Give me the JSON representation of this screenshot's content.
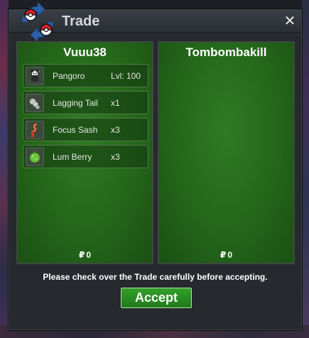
{
  "window": {
    "title": "Trade",
    "close_symbol": "✕"
  },
  "left_trader": {
    "name": "Vuuu38",
    "items": [
      {
        "name": "Pangoro",
        "qty": "Lvl: 100",
        "icon": "pangoro-icon"
      },
      {
        "name": "Lagging Tail",
        "qty": "x1",
        "icon": "lagging-tail-icon"
      },
      {
        "name": "Focus Sash",
        "qty": "x3",
        "icon": "focus-sash-icon"
      },
      {
        "name": "Lum Berry",
        "qty": "x3",
        "icon": "lum-berry-icon"
      }
    ],
    "money_symbol": "₽",
    "money": "0"
  },
  "right_trader": {
    "name": "Tombombakill",
    "items": [],
    "money_symbol": "₽",
    "money": "0"
  },
  "footer": {
    "notice": "Please check over the Trade carefully before accepting.",
    "accept_label": "Accept"
  },
  "colors": {
    "panel_green": "#236619",
    "accept_green": "#2a8f23",
    "dialog_bg": "#26292e",
    "logo_blue": "#2f5fa8",
    "logo_red": "#d2242a"
  }
}
